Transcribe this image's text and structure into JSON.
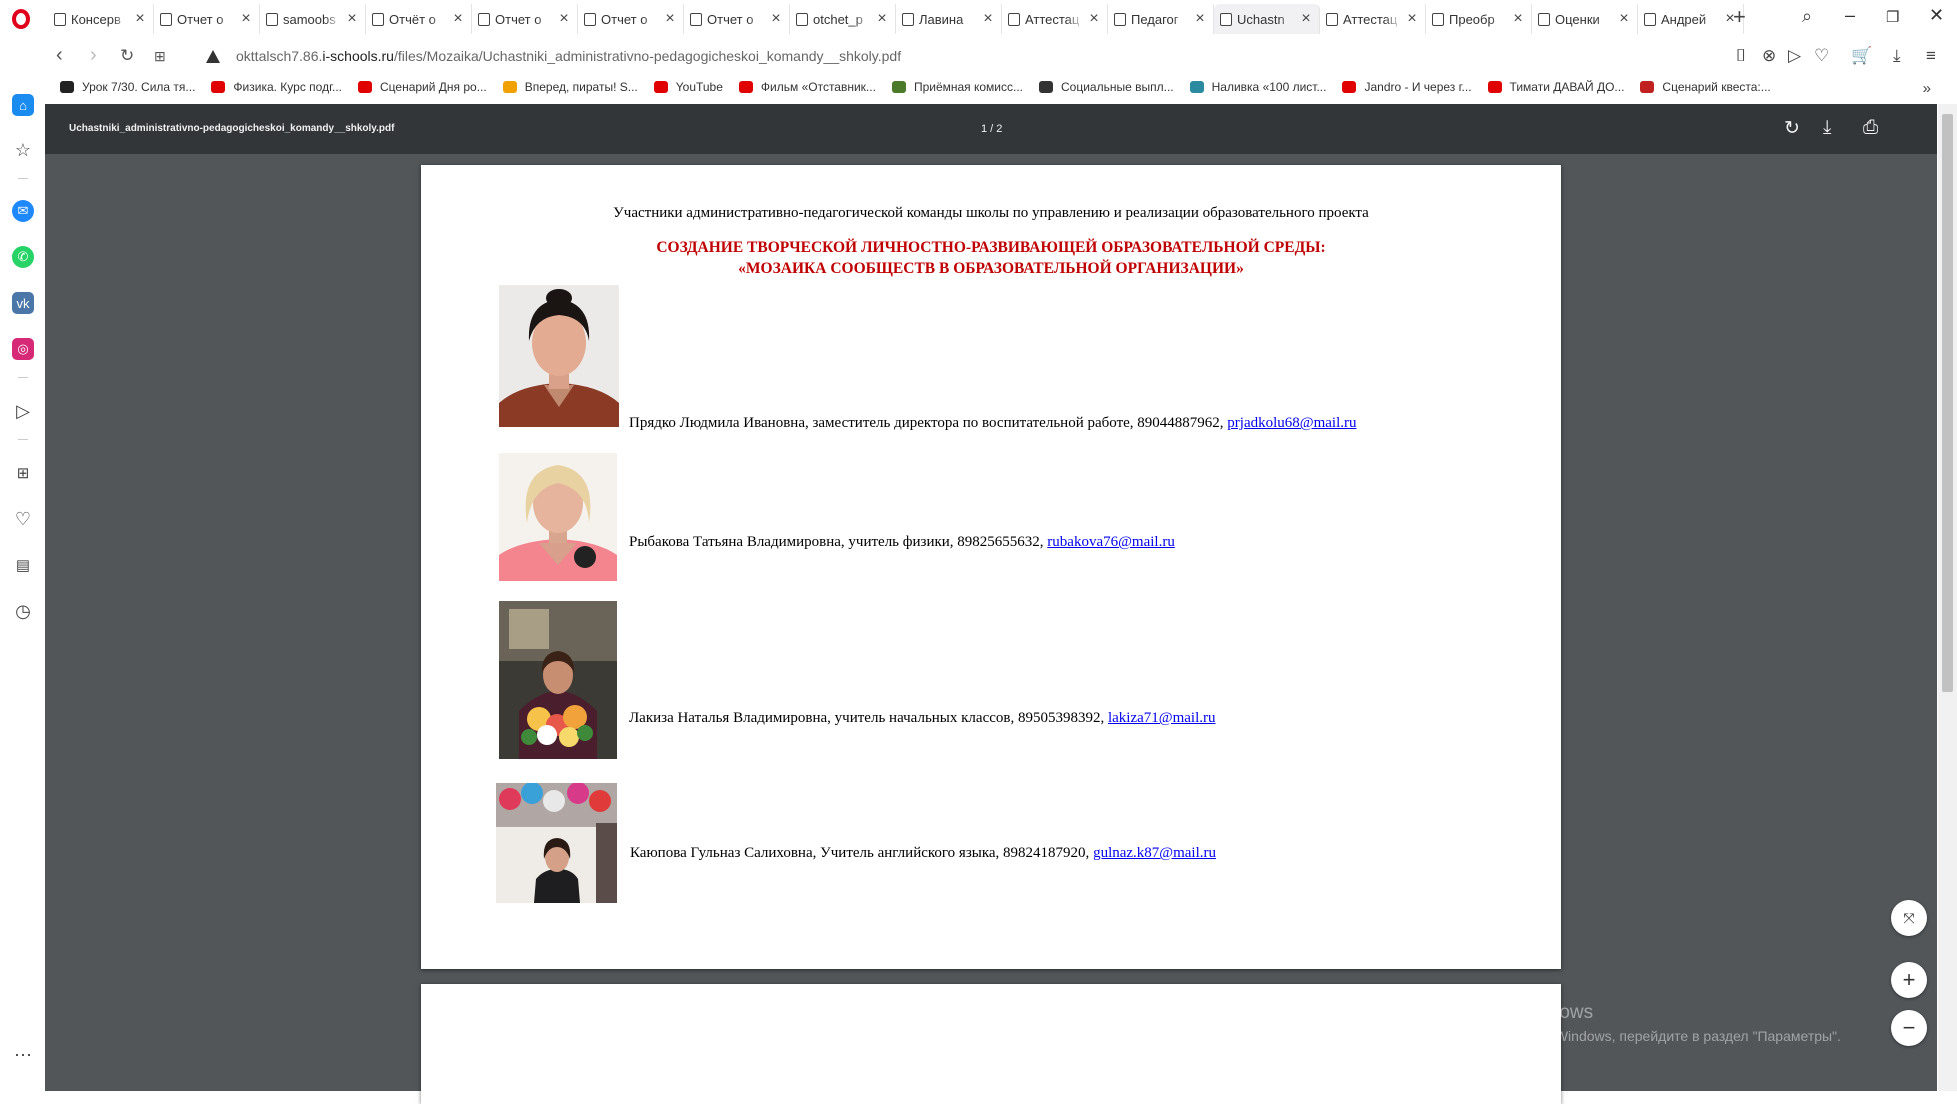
{
  "tabs": [
    {
      "label": "Консерв",
      "active": false
    },
    {
      "label": "Отчет о",
      "active": false
    },
    {
      "label": "samoobs",
      "active": false
    },
    {
      "label": "Отчёт о",
      "active": false
    },
    {
      "label": "Отчет о",
      "active": false
    },
    {
      "label": "Отчет о",
      "active": false
    },
    {
      "label": "Отчет о",
      "active": false
    },
    {
      "label": "otchet_p",
      "active": false
    },
    {
      "label": "Лавина",
      "active": false
    },
    {
      "label": "Аттестац",
      "active": false
    },
    {
      "label": "Педагог",
      "active": false
    },
    {
      "label": "Uchastn",
      "active": true
    },
    {
      "label": "Аттестац",
      "active": false
    },
    {
      "label": "Преобр",
      "active": false
    },
    {
      "label": "Оценки",
      "active": false
    },
    {
      "label": "Андрей",
      "active": false
    }
  ],
  "address": {
    "url_prefix": "okttalsch7.86.",
    "url_host": "i-schools.ru",
    "url_path": "/files/Mozaika/Uchastniki_administrativno-pedagogicheskoi_komandy__shkoly.pdf"
  },
  "bookmarks": [
    {
      "label": "Урок 7/30. Сила тя...",
      "color": "#222222"
    },
    {
      "label": "Физика. Курс подг...",
      "color": "#e00000"
    },
    {
      "label": "Сценарий Дня ро...",
      "color": "#e00000"
    },
    {
      "label": "Вперед, пираты! S...",
      "color": "#f0a000"
    },
    {
      "label": "YouTube",
      "color": "#e00000"
    },
    {
      "label": "Фильм «Отставник...",
      "color": "#e00000"
    },
    {
      "label": "Приёмная комисс...",
      "color": "#4a7a2a"
    },
    {
      "label": "Социальные выпл...",
      "color": "#333333"
    },
    {
      "label": "Наливка «100 лист...",
      "color": "#2a8aa0"
    },
    {
      "label": "Jandro - И через г...",
      "color": "#e00000"
    },
    {
      "label": "Тимати ДАВАЙ ДО...",
      "color": "#e00000"
    },
    {
      "label": "Сценарий квеста:...",
      "color": "#c02020"
    }
  ],
  "pdf": {
    "filename": "Uchastniki_administrativno-pedagogicheskoi_komandy__shkoly.pdf",
    "pages": "1 / 2",
    "heading": "Участники административно-педагогической команды школы по управлению и реализации образовательного проекта",
    "title_line1": "СОЗДАНИЕ ТВОРЧЕСКОЙ ЛИЧНОСТНО-РАЗВИВАЮЩЕЙ ОБРАЗОВАТЕЛЬНОЙ СРЕДЫ:",
    "title_line2": "«МОЗАИКА СООБЩЕСТВ В ОБРАЗОВАТЕЛЬНОЙ ОРГАНИЗАЦИИ»",
    "people": [
      {
        "text": "Прядко Людмила Ивановна, заместитель директора по воспитательной работе, 89044887962, ",
        "email": "prjadkolu68@mail.ru"
      },
      {
        "text": "Рыбакова Татьяна Владимировна, учитель физики, 89825655632, ",
        "email": "rubakova76@mail.ru"
      },
      {
        "text": "Лакиза Наталья Владимировна, учитель начальных классов, 89505398392, ",
        "email": "lakiza71@mail.ru"
      },
      {
        "text": "Каюпова Гульназ Салиховна, Учитель английского языка, 89824187920, ",
        "email": "gulnaz.k87@mail.ru"
      }
    ]
  },
  "activation": {
    "title": "Активация Windows",
    "subtitle": "Чтобы активировать Windows, перейдите в раздел \"Параметры\"."
  }
}
